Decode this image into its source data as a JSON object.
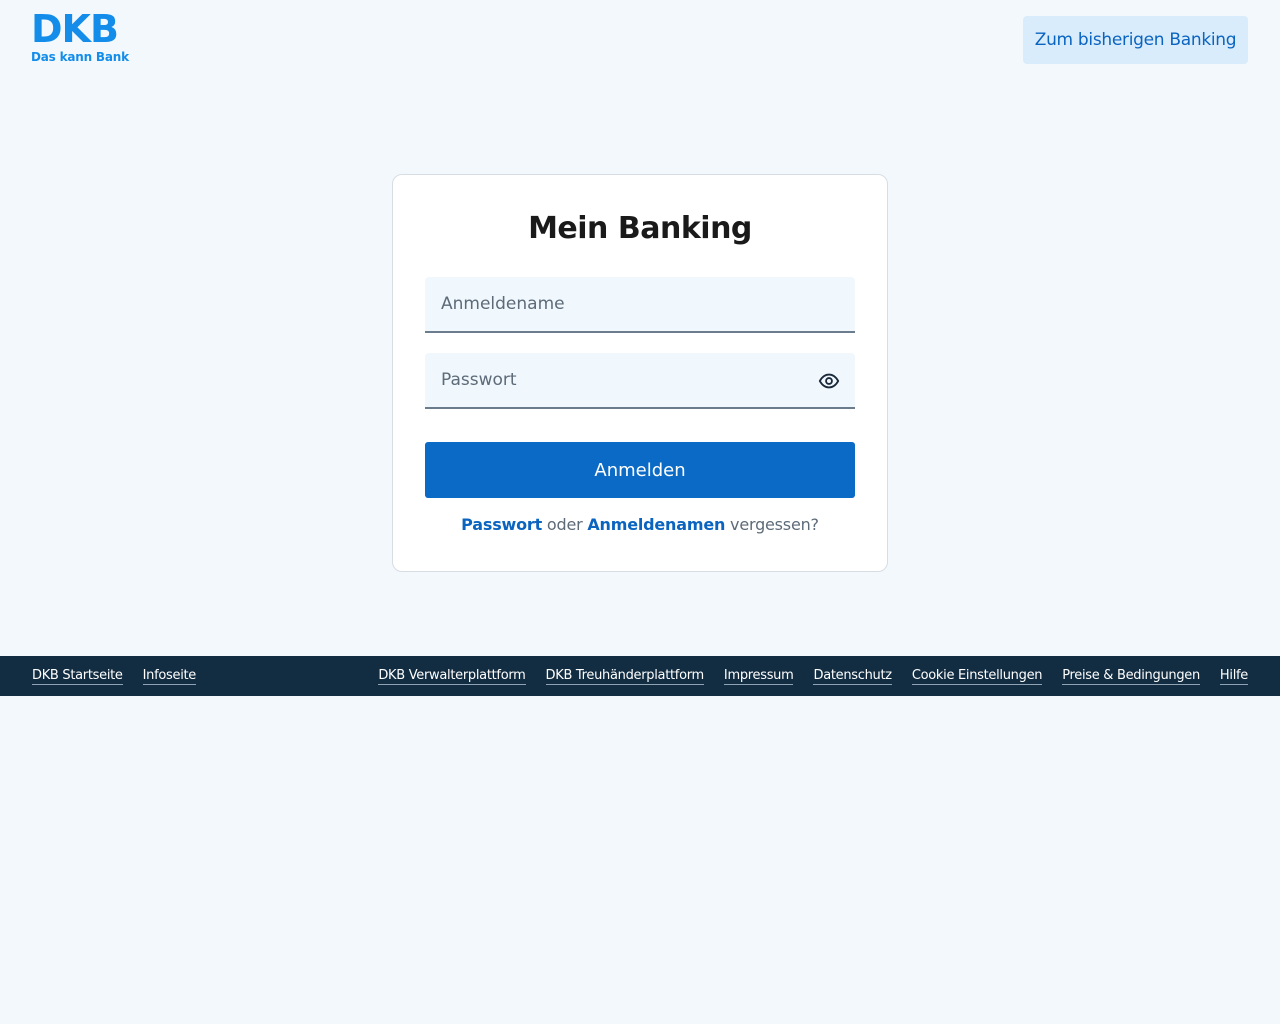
{
  "header": {
    "logo_mark": "DKB",
    "logo_tagline": "Das kann Bank",
    "legacy_button_label": "Zum bisherigen Banking"
  },
  "login": {
    "title": "Mein Banking",
    "username_placeholder": "Anmeldename",
    "username_value": "",
    "password_placeholder": "Passwort",
    "password_value": "",
    "submit_label": "Anmelden",
    "forgot": {
      "password_link": "Passwort",
      "connector": " oder ",
      "username_link": "Anmeldenamen",
      "suffix": " vergessen?"
    }
  },
  "footer": {
    "left_links": [
      "DKB Startseite",
      "Infoseite"
    ],
    "right_links": [
      "DKB Verwalterplattform",
      "DKB Treuhänderplattform",
      "Impressum",
      "Datenschutz",
      "Cookie Einstellungen",
      "Preise & Bedingungen",
      "Hilfe"
    ]
  },
  "colors": {
    "brand_blue": "#148DEA",
    "primary_button": "#0a6ac6",
    "link_blue": "#0a64c0",
    "footer_bg": "#122c41",
    "page_bg": "#f3f8fd"
  },
  "icons": {
    "password_toggle": "eye-icon"
  }
}
